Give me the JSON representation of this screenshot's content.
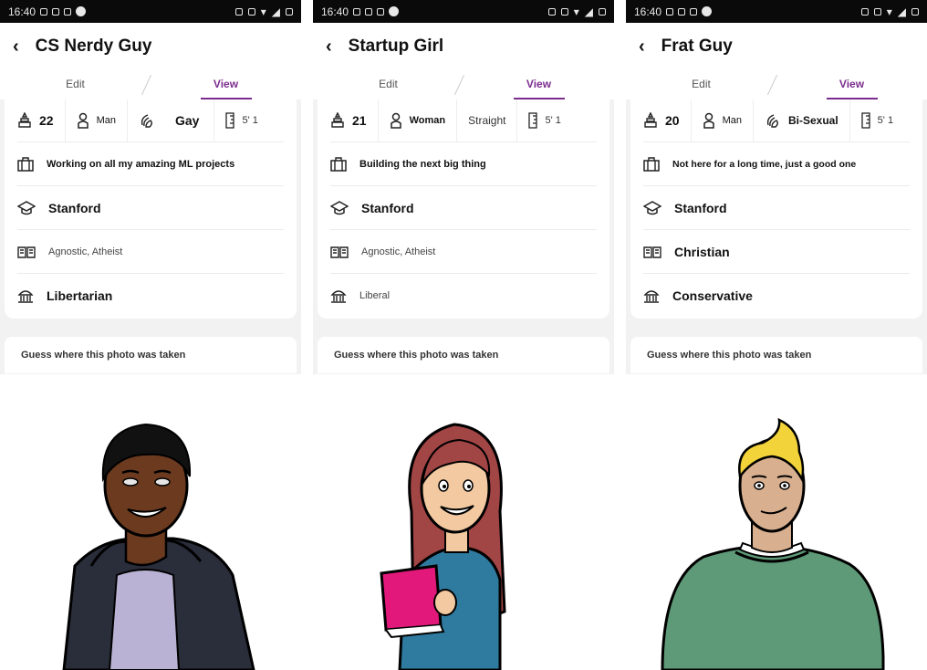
{
  "status_bar": {
    "time": "16:40"
  },
  "tabs": {
    "edit": "Edit",
    "view": "View"
  },
  "prompt_text": "Guess where this photo was taken",
  "colors": {
    "accent": "#7b2d8e"
  },
  "profiles": [
    {
      "name": "CS Nerdy Guy",
      "age": "22",
      "gender": "Man",
      "sexuality": "Gay",
      "height": "5' 1",
      "job": "Working on all my amazing ML projects",
      "school": "Stanford",
      "religion": "Agnostic, Atheist",
      "politics": "Libertarian"
    },
    {
      "name": "Startup Girl",
      "age": "21",
      "gender": "Woman",
      "sexuality": "Straight",
      "height": "5' 1",
      "job": "Building the next big thing",
      "school": "Stanford",
      "religion": "Agnostic, Atheist",
      "politics": "Liberal"
    },
    {
      "name": "Frat Guy",
      "age": "20",
      "gender": "Man",
      "sexuality": "Bi-Sexual",
      "height": "5' 1",
      "job": "Not here for a long time, just a good one",
      "school": "Stanford",
      "religion": "Christian",
      "politics": "Conservative"
    }
  ]
}
